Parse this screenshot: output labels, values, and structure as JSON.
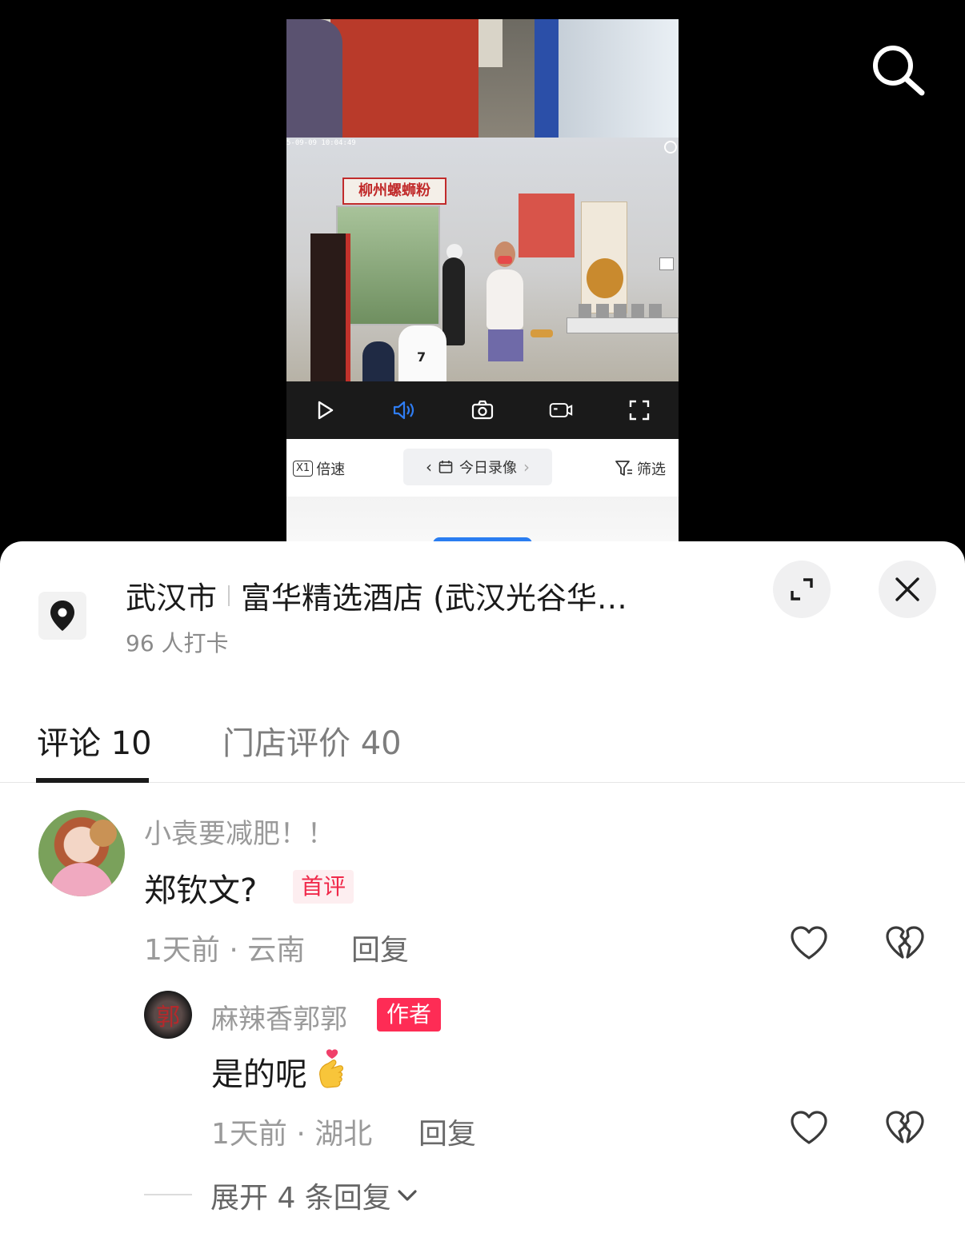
{
  "video": {
    "timestamp": "5-09-09 10:04:49",
    "banner_text": "柳州螺蛳粉",
    "jersey_number": "7",
    "toolbar": {
      "speed_badge": "X1",
      "speed_label": "倍速",
      "date_label": "今日录像",
      "filter_label": "筛选"
    }
  },
  "location": {
    "city": "武汉市",
    "place": "富华精选酒店 (武汉光谷华…",
    "checkins": "96 人打卡"
  },
  "tabs": [
    {
      "label": "评论 10",
      "active": true
    },
    {
      "label": "门店评价 40",
      "active": false
    }
  ],
  "comments": [
    {
      "user": "小袁要减肥！！",
      "text": "郑钦文?",
      "badge": "首评",
      "meta": "1天前 · 云南",
      "reply_label": "回复",
      "replies": [
        {
          "user": "麻辣香郭郭",
          "avatar_char": "郭",
          "badge": "作者",
          "text": "是的呢",
          "meta": "1天前 · 湖北",
          "reply_label": "回复"
        }
      ],
      "expand_label": "展开 4 条回复"
    }
  ],
  "colors": {
    "accent_red": "#fe2c55",
    "text_primary": "#1a1a1a",
    "text_secondary": "#9a9a9a"
  }
}
